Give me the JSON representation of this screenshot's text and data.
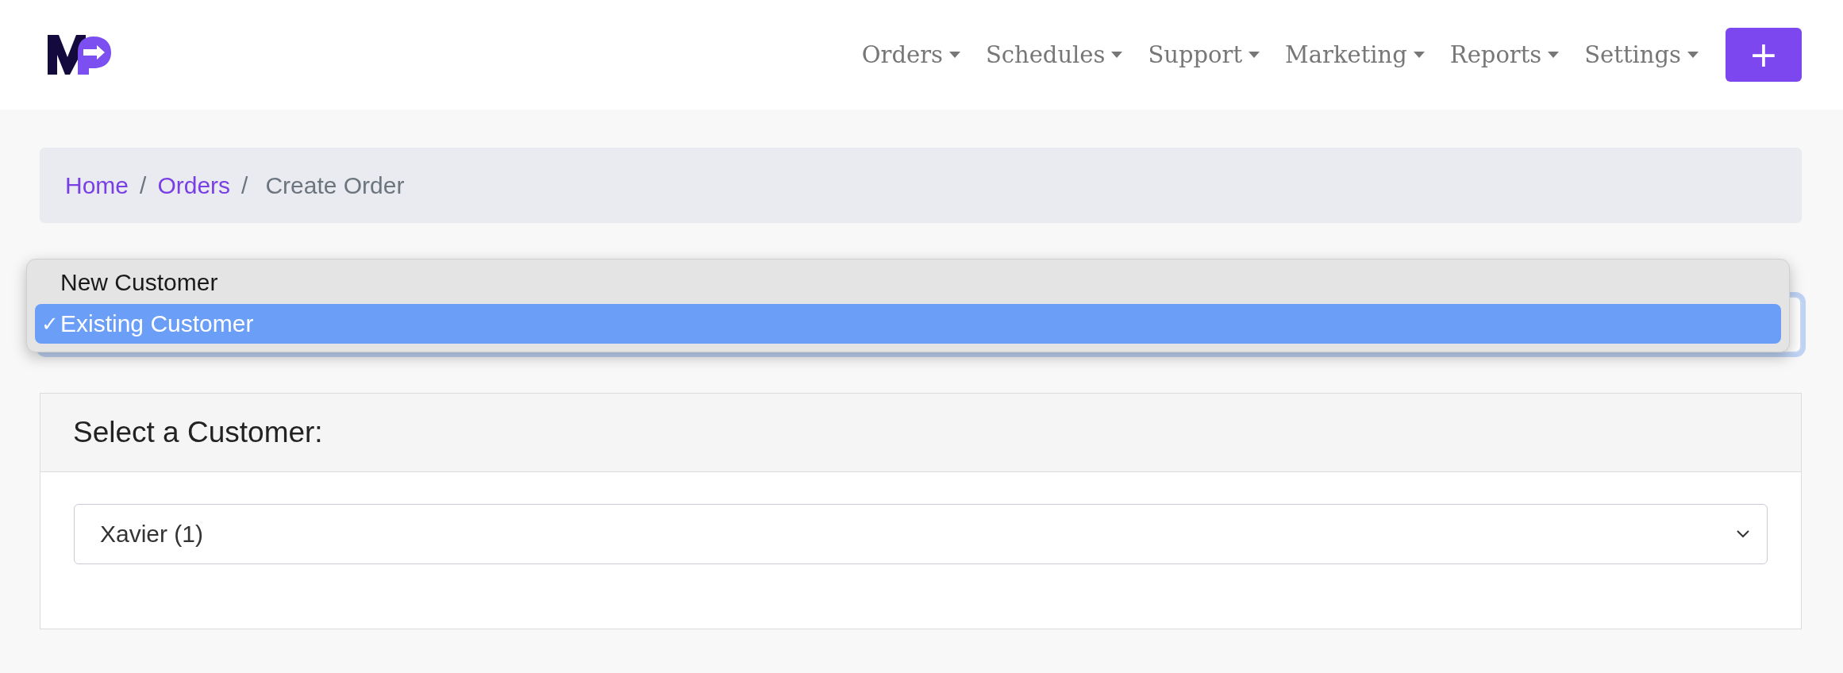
{
  "nav": {
    "menus": [
      {
        "label": "Orders"
      },
      {
        "label": "Schedules"
      },
      {
        "label": "Support"
      },
      {
        "label": "Marketing"
      },
      {
        "label": "Reports"
      },
      {
        "label": "Settings"
      }
    ],
    "add_button": "+"
  },
  "breadcrumb": {
    "separator": "/",
    "items": [
      {
        "label": "Home",
        "kind": "link"
      },
      {
        "label": "Orders",
        "kind": "link"
      },
      {
        "label": "Create Order",
        "kind": "current"
      }
    ]
  },
  "customer_type": {
    "check_mark": "✓",
    "options": [
      {
        "label": "New Customer",
        "selected": false
      },
      {
        "label": "Existing Customer",
        "selected": true
      }
    ]
  },
  "customer_card": {
    "title": "Select a Customer:",
    "select": {
      "value": "Xavier (1)"
    }
  }
}
